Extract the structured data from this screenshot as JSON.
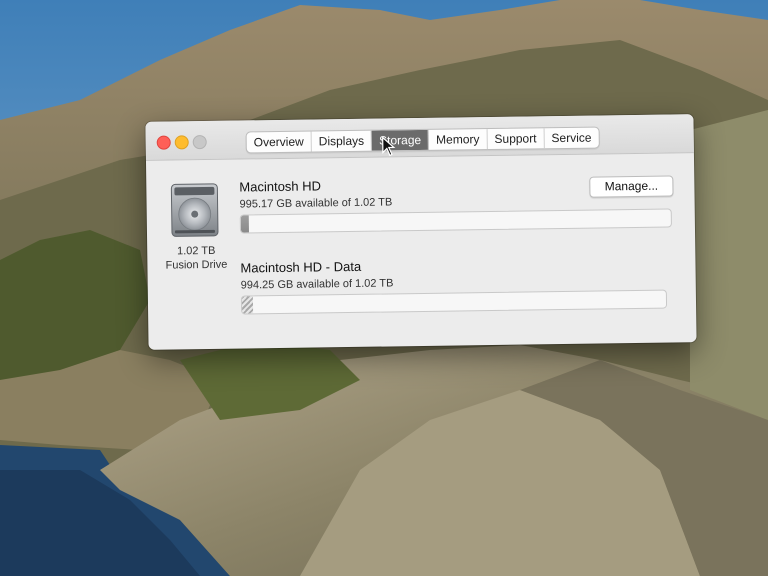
{
  "tabs": [
    "Overview",
    "Displays",
    "Storage",
    "Memory",
    "Support",
    "Service"
  ],
  "active_tab": "Storage",
  "disk": {
    "icon": "hard-drive-icon",
    "size": "1.02 TB",
    "type": "Fusion Drive"
  },
  "volumes": [
    {
      "name": "Macintosh HD",
      "available": "995.17 GB available of 1.02 TB",
      "used_fraction": 0.018
    },
    {
      "name": "Macintosh HD - Data",
      "available": "994.25 GB available of 1.02 TB",
      "used_fraction": 0.025
    }
  ],
  "manage_button": "Manage...",
  "colors": {
    "close": "#fe5f57",
    "minimize": "#febc2e",
    "zoom": "#c8c8c8",
    "active_tab": "#6b6b6b"
  }
}
